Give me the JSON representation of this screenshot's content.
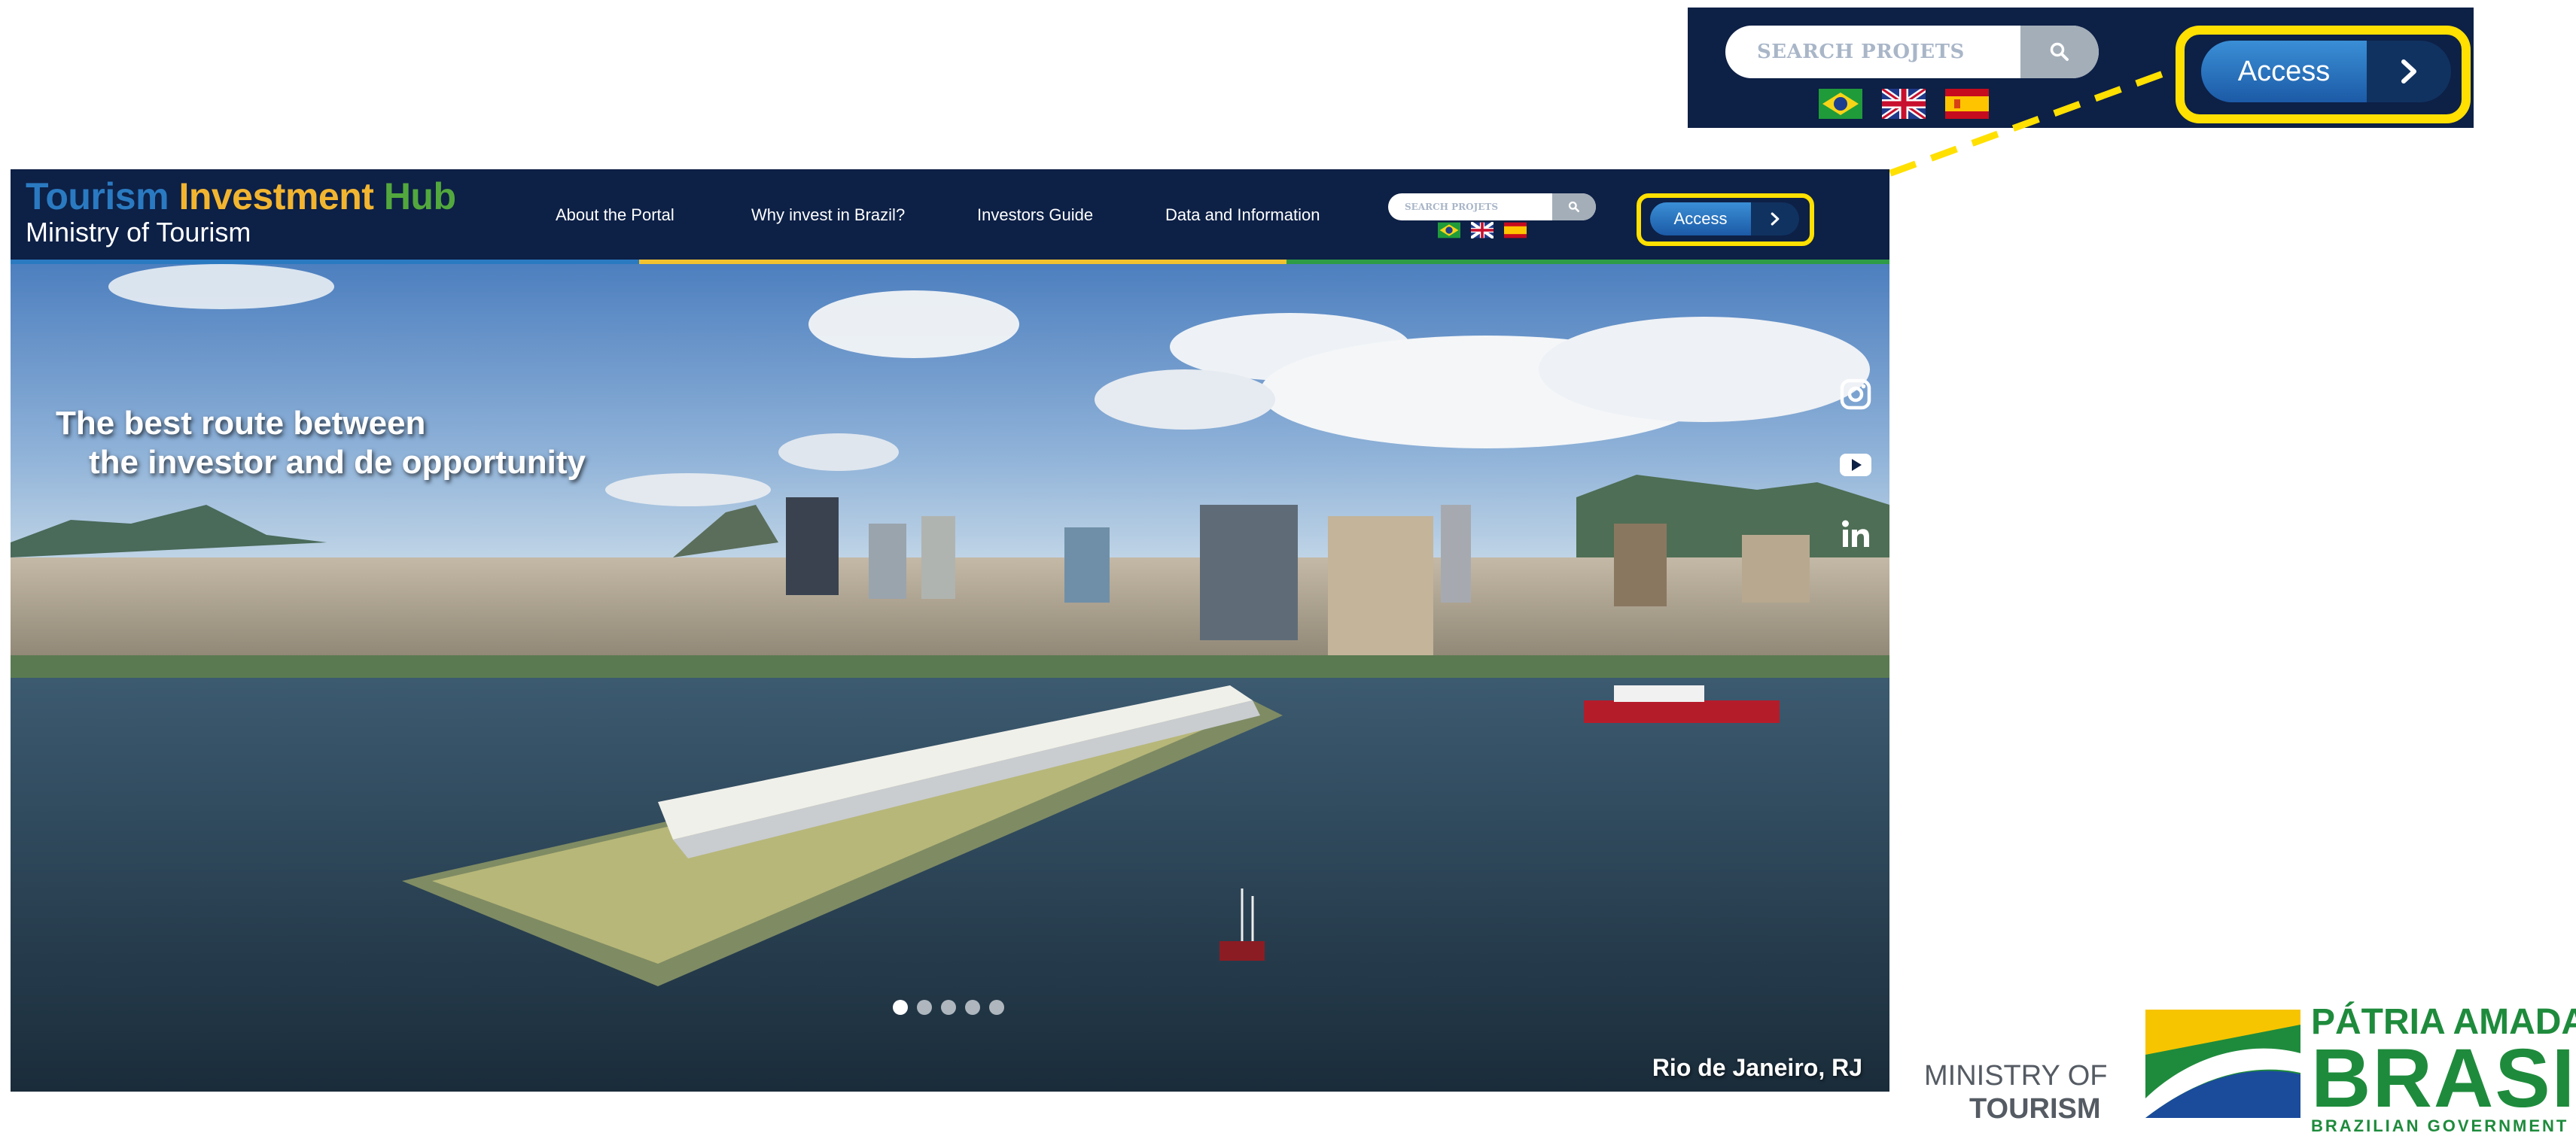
{
  "zoom_callout": {
    "search_placeholder": "SEARCH PROJETS",
    "search_icon": "search-icon",
    "flags": [
      "brazil-flag",
      "uk-flag",
      "spain-flag"
    ],
    "access_label": "Access",
    "access_icon": "chevron-right-icon",
    "highlight_color": "#ffe000"
  },
  "site": {
    "logo": {
      "word1": "Tourism",
      "word2": "Investment",
      "word3": "Hub",
      "subtitle": "Ministry of Tourism"
    },
    "nav": {
      "items": [
        {
          "label": "About the Portal"
        },
        {
          "label": "Why invest in Brazil?"
        },
        {
          "label": "Investors Guide"
        },
        {
          "label": "Data and Information"
        }
      ]
    },
    "search": {
      "placeholder": "SEARCH PROJETS",
      "icon": "search-icon"
    },
    "languages": [
      "Português",
      "English",
      "Español"
    ],
    "access": {
      "label": "Access",
      "icon": "chevron-right-icon"
    },
    "hero": {
      "headline_line1": "The best route between",
      "headline_line2": "the investor and de opportunity",
      "caption": "Rio de Janeiro, RJ",
      "slides_total": 5,
      "slide_active": 1,
      "social": [
        "instagram-icon",
        "youtube-icon",
        "linkedin-icon"
      ]
    },
    "colors": {
      "navy": "#0d2046",
      "blue": "#2a7ac1",
      "yellow": "#f2b530",
      "green": "#52a83d"
    }
  },
  "footer": {
    "ministry_line1": "MINISTRY OF",
    "ministry_line2": "TOURISM",
    "brand_line1": "PÁTRIA AMADA",
    "brand_line2": "BRASIL",
    "brand_line3": "BRAZILIAN GOVERNMENT"
  }
}
